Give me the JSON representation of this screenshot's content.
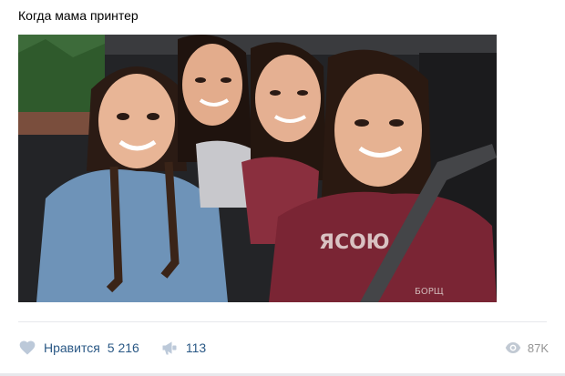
{
  "post": {
    "text": "Когда мама принтер",
    "photo_alt": "Четыре девушки в машине делают селфи",
    "photo_text": {
      "shirt": "ЯСОЮ",
      "watermark": "БОРЩ"
    }
  },
  "actions": {
    "like_label": "Нравится",
    "like_count": "5 216",
    "repost_count": "113",
    "views_count": "87K"
  },
  "colors": {
    "link": "#2a5885",
    "icon": "#bcc9d9",
    "muted": "#939393",
    "divider": "#e7e8ec"
  },
  "icons": [
    "heart-icon",
    "megaphone-icon",
    "eye-icon"
  ]
}
